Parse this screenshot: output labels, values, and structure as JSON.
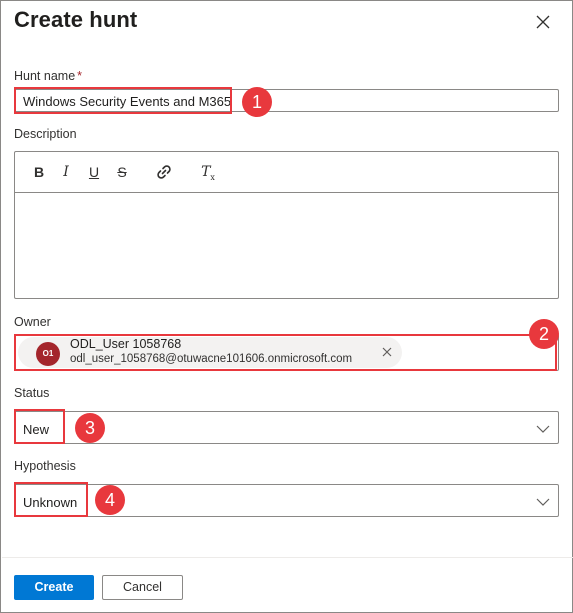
{
  "dialog": {
    "title": "Create hunt",
    "close_icon": "close-icon"
  },
  "fields": {
    "hunt_name": {
      "label": "Hunt name",
      "required_marker": "*",
      "value": "Windows Security Events and M365"
    },
    "description": {
      "label": "Description",
      "toolbar": [
        {
          "name": "bold-icon",
          "glyph": "B"
        },
        {
          "name": "italic-icon",
          "glyph": "I"
        },
        {
          "name": "underline-icon",
          "glyph": "U"
        },
        {
          "name": "strikethrough-icon",
          "glyph": "S"
        },
        {
          "name": "link-icon",
          "glyph": ""
        },
        {
          "name": "clear-format-icon",
          "glyph": "T"
        }
      ],
      "value": ""
    },
    "owner": {
      "label": "Owner",
      "persona": {
        "initials": "O1",
        "name": "ODL_User 1058768",
        "email": "odl_user_1058768@otuwacne101606.onmicrosoft.com",
        "avatar_color": "#a4262c"
      }
    },
    "status": {
      "label": "Status",
      "selected": "New"
    },
    "hypothesis": {
      "label": "Hypothesis",
      "selected": "Unknown"
    }
  },
  "footer": {
    "create_label": "Create",
    "cancel_label": "Cancel"
  },
  "annotations": {
    "color": "#e8383d",
    "markers": [
      "1",
      "2",
      "3",
      "4"
    ]
  },
  "colors": {
    "primary": "#0078d4",
    "border": "#8a8886",
    "required": "#a4262c"
  }
}
